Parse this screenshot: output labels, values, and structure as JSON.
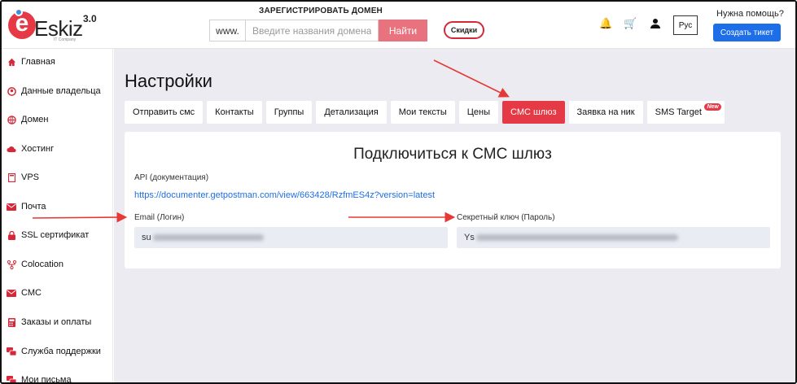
{
  "brand": {
    "logo_letter": "e",
    "name": "Eskiz",
    "version": "3.0",
    "subtitle": "IT Company"
  },
  "header": {
    "register_title": "ЗАРЕГИСТРИРОВАТЬ ДОМЕН",
    "domain_prefix": "www.",
    "domain_placeholder": "Введите названия домена",
    "search_button": "Найти",
    "discount_button": "Скидки",
    "language": "Рус",
    "help_text": "Нужна помощь?",
    "ticket_button": "Создать тикет",
    "icons": [
      "bell-icon",
      "cart-icon",
      "user-icon"
    ]
  },
  "sidebar": {
    "items": [
      {
        "label": "Главная",
        "icon": "home-icon"
      },
      {
        "label": "Данные владельца",
        "icon": "owner-icon"
      },
      {
        "label": "Домен",
        "icon": "globe-icon"
      },
      {
        "label": "Хостинг",
        "icon": "cloud-icon"
      },
      {
        "label": "VPS",
        "icon": "server-icon"
      },
      {
        "label": "Почта",
        "icon": "mail-icon"
      },
      {
        "label": "SSL сертификат",
        "icon": "lock-icon"
      },
      {
        "label": "Colocation",
        "icon": "network-icon"
      },
      {
        "label": "СМС",
        "icon": "sms-icon"
      },
      {
        "label": "Заказы и оплаты",
        "icon": "calculator-icon"
      },
      {
        "label": "Служба поддержки",
        "icon": "support-icon"
      },
      {
        "label": "Мои письма",
        "icon": "letters-icon"
      }
    ]
  },
  "main": {
    "title": "Настройки",
    "tabs": [
      {
        "label": "Отправить смс"
      },
      {
        "label": "Контакты"
      },
      {
        "label": "Группы"
      },
      {
        "label": "Детализация"
      },
      {
        "label": "Мои тексты"
      },
      {
        "label": "Цены"
      },
      {
        "label": "СМС шлюз",
        "active": true
      },
      {
        "label": "Заявка на ник"
      },
      {
        "label": "SMS Target",
        "badge": "New"
      }
    ],
    "card": {
      "title": "Подключиться к СМС шлюз",
      "api_label": "API (документация)",
      "api_link": "https://documenter.getpostman.com/view/663428/RzfmES4z?version=latest",
      "email_label": "Email (Логин)",
      "email_value_visible": "su",
      "secret_label": "Секретный ключ (Пароль)",
      "secret_value_visible": "Ys"
    }
  },
  "colors": {
    "accent_red": "#e63946",
    "link_blue": "#1d6ee8",
    "arrow_red": "#e53935"
  }
}
